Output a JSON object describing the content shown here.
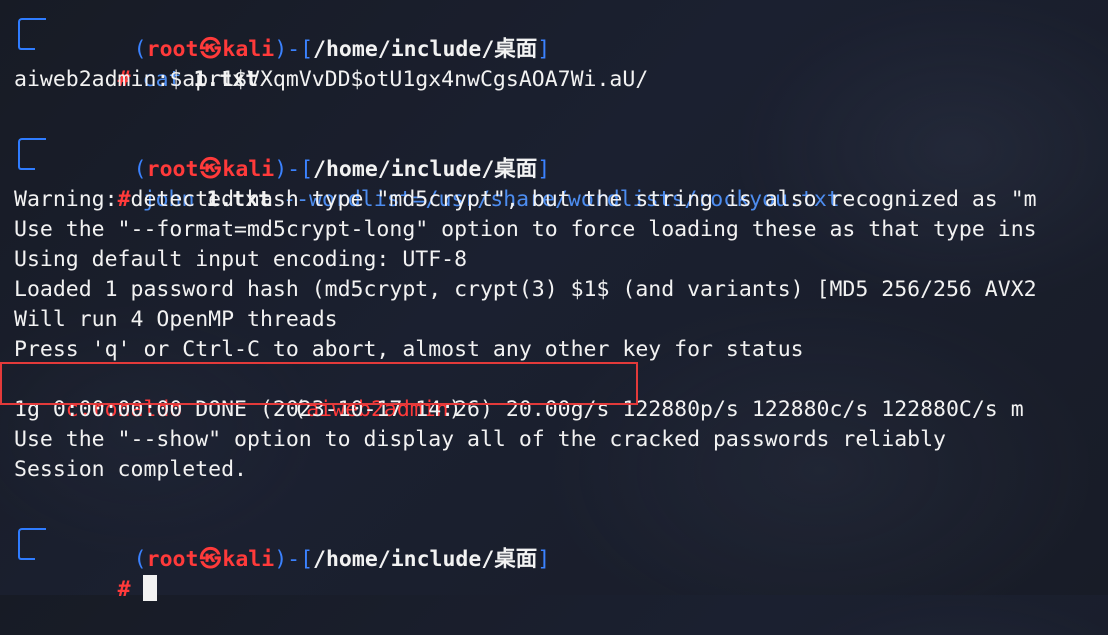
{
  "terminal": {
    "prompt": {
      "open": "(",
      "user": "root",
      "skull": "㉿",
      "host": "kali",
      "close": ")",
      "dash": "-",
      "cwd_open": "[",
      "cwd": "/home/include/桌面",
      "cwd_close": "]",
      "hash": "#"
    },
    "blocks": [
      {
        "command": "cat",
        "args": "1.txt",
        "output": [
          "aiweb2admin:$apr1$VXqmVvDD$otU1gx4nwCgsAOA7Wi.aU/"
        ]
      },
      {
        "command": "john",
        "args_bold": "1.txt",
        "args_rest": "--wordlist=/usr/share/wordlists/rockyou.txt",
        "output": [
          "Warning: detected hash type \"md5crypt\", but the string is also recognized as \"m",
          "Use the \"--format=md5crypt-long\" option to force loading these as that type ins",
          "Using default input encoding: UTF-8",
          "Loaded 1 password hash (md5crypt, crypt(3) $1$ (and variants) [MD5 256/256 AVX2",
          "Will run 4 OpenMP threads",
          "Press 'q' or Ctrl-C to abort, almost any other key for status",
          "c.ronaldo",
          "(aiweb2admin)",
          "1g 0:00:00:00 DONE (2023-10-17 14:26) 20.00g/s 122880p/s 122880c/s 122880C/s m",
          "Use the \"--show\" option to display all of the cracked passwords reliably",
          "Session completed."
        ]
      }
    ]
  }
}
